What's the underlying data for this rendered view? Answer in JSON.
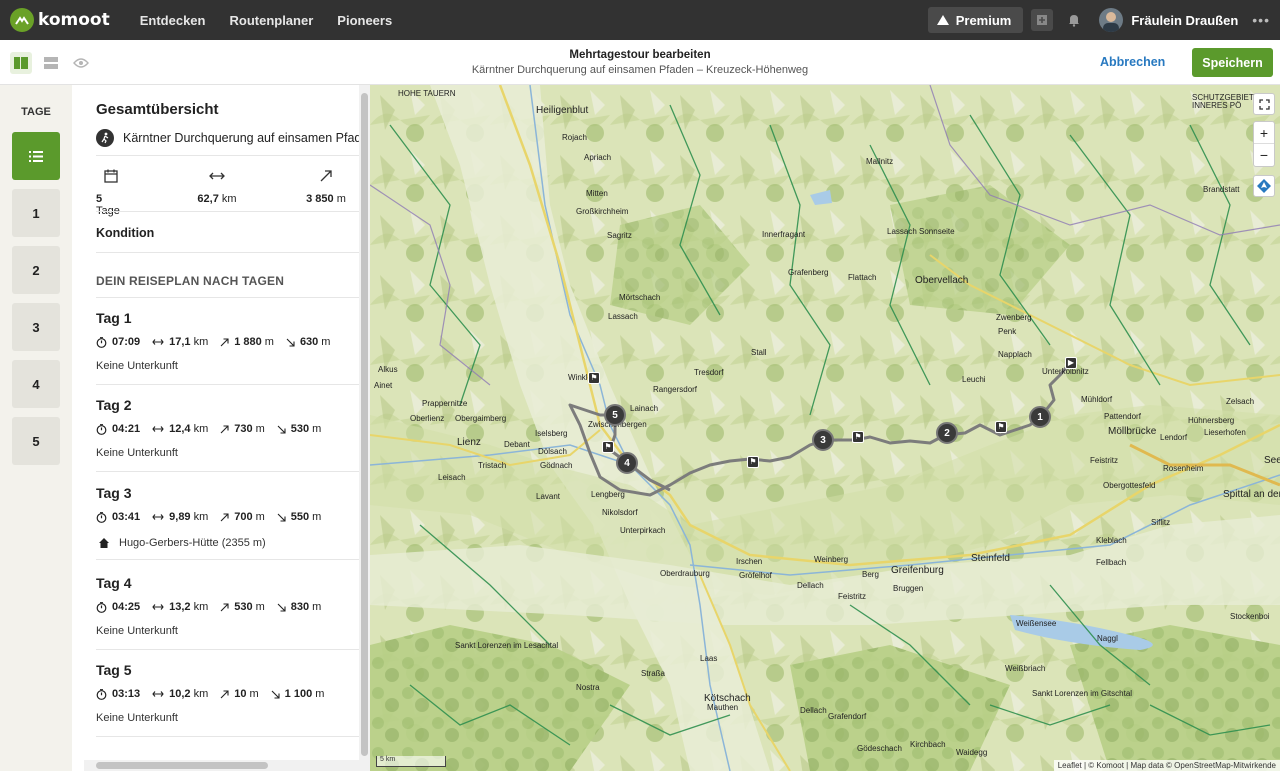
{
  "nav": {
    "brand": "komoot",
    "links": [
      "Entdecken",
      "Routenplaner",
      "Pioneers"
    ],
    "premium": "Premium",
    "user": "Fräulein Draußen",
    "more": "•••"
  },
  "subbar": {
    "title": "Mehrtagestour bearbeiten",
    "subtitle": "Kärntner Durchquerung auf einsamen Pfaden – Kreuzeck-Höhenweg",
    "cancel": "Abbrechen",
    "save": "Speichern"
  },
  "days": {
    "label": "TAGE",
    "buttons": [
      "1",
      "2",
      "3",
      "4",
      "5"
    ]
  },
  "panel": {
    "title": "Gesamtübersicht",
    "tour_name": "Kärntner Durchquerung auf einsamen Pfaden",
    "stats": {
      "days_value": "5",
      "days_unit": "Tage",
      "distance_value": "62,7",
      "distance_unit": "km",
      "elevation_value": "3 850",
      "elevation_unit": "m"
    },
    "kondition": "Kondition",
    "plan_heading": "DEIN REISEPLAN NACH TAGEN",
    "plan": [
      {
        "title": "Tag 1",
        "time": "07:09",
        "dist": "17,1",
        "up": "1 880",
        "down": "630",
        "note": "Keine Unterkunft"
      },
      {
        "title": "Tag 2",
        "time": "04:21",
        "dist": "12,4",
        "up": "730",
        "down": "530",
        "note": "Keine Unterkunft"
      },
      {
        "title": "Tag 3",
        "time": "03:41",
        "dist": "9,89",
        "up": "700",
        "down": "550",
        "note": "Hugo-Gerbers-Hütte (2355 m)"
      },
      {
        "title": "Tag 4",
        "time": "04:25",
        "dist": "13,2",
        "up": "530",
        "down": "830",
        "note": "Keine Unterkunft"
      },
      {
        "title": "Tag 5",
        "time": "03:13",
        "dist": "10,2",
        "up": "10",
        "down": "1 100",
        "note": "Keine Unterkunft"
      }
    ],
    "units": {
      "km": "km",
      "m": "m"
    }
  },
  "map": {
    "places": {
      "heiligenblut": "Heiligenblut",
      "hohe_tauern": "HOHE TAUERN",
      "schutzgebiet": "SCHUTZGEBIET",
      "inneres": "INNERES PÖ",
      "rojach": "Rojach",
      "apriach": "Apriach",
      "mitten": "Mitten",
      "grosskirchheim": "Großkirchheim",
      "sagritz": "Sagritz",
      "mallnitz": "Mallnitz",
      "innerfragant": "Innerfragant",
      "lassach_sonnseite": "Lassach Sonnseite",
      "brandstatt": "Brandstatt",
      "grafenberg": "Grafenberg",
      "flattach": "Flattach",
      "obervellach": "Obervellach",
      "mortschach": "Mörtschach",
      "lassach": "Lassach",
      "stall": "Stall",
      "zwenberg": "Zwenberg",
      "penk": "Penk",
      "napplach": "Napplach",
      "unterkolbnitz": "Unterkolbnitz",
      "alkus": "Alkus",
      "ainet": "Ainet",
      "winklern": "Winklern",
      "tresdorf": "Tresdorf",
      "rangersdorf": "Rangersdorf",
      "leuchi": "Leuchi",
      "muhldorf": "Mühldorf",
      "zelsach": "Zelsach",
      "lainach": "Lainach",
      "prappernitze": "Prappernitze",
      "oberlienz": "Oberlienz",
      "obergaimberg": "Obergaimberg",
      "zwischenbergen": "Zwischenbergen",
      "pattendorf": "Pattendorf",
      "huhnersberg": "Hühnersberg",
      "lienz": "Lienz",
      "debant": "Debant",
      "iselsberg": "Iselsberg",
      "mollbrucke": "Möllbrücke",
      "lendorf": "Lendorf",
      "lieserhofen": "Lieserhofen",
      "dolsach": "Dölsach",
      "tristach": "Tristach",
      "godnach": "Gödnach",
      "leisach": "Leisach",
      "rosenheim": "Rosenheim",
      "feistritz": "Feistritz",
      "obergottesfeld": "Obergottesfeld",
      "spittal": "Spittal an der",
      "lavant": "Lavant",
      "lengberg": "Lengberg",
      "nikolsdorf": "Nikolsdorf",
      "siflitz": "Siflitz",
      "kleblach": "Kleblach",
      "unterpirkach": "Unterpirkach",
      "irschen": "Irschen",
      "weinberg": "Weinberg",
      "steinfeld": "Steinfeld",
      "fellbach": "Fellbach",
      "oberdrauburg": "Oberdrauburg",
      "grofelhof": "Gröfelhof",
      "dellach": "Dellach",
      "berg": "Berg",
      "greifenburg": "Greifenburg",
      "bruggen": "Bruggen",
      "feistritz2": "Feistritz",
      "weissensee": "Weißensee",
      "naggl": "Naggl",
      "stockenboi": "Stockenboi",
      "sankt_lorenzen": "Sankt Lorenzen im Lesachtal",
      "laas": "Laas",
      "strassa": "Straßa",
      "weissbriach": "Weißbriach",
      "nostra": "Nostra",
      "kotschach": "Kötschach",
      "sankt_lorenzen_gitschtal": "Sankt Lorenzen im Gitschtal",
      "mauthen": "Mauthen",
      "dellach2": "Dellach",
      "grafendorf": "Grafendorf",
      "waidegg": "Waidegg",
      "kirchbach": "Kirchbach",
      "godeschach": "Gödeschach",
      "see": "See"
    },
    "markers": [
      "1",
      "2",
      "3",
      "4",
      "5"
    ],
    "scale": "5 km",
    "attribution": "Leaflet | © Komoot | Map data © OpenStreetMap-Mitwirkende",
    "zoom_in": "+",
    "zoom_out": "−"
  },
  "colors": {
    "brand_green": "#5b9a2c",
    "link_blue": "#2879c0",
    "route": "#7c7c7c"
  }
}
